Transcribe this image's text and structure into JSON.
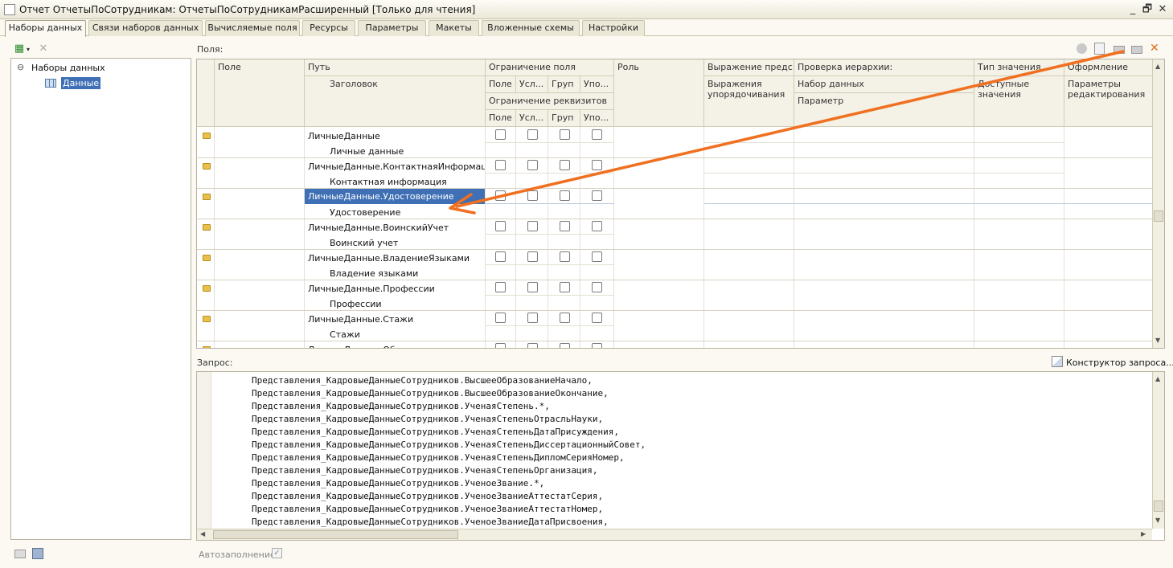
{
  "window": {
    "title": "Отчет ОтчетыПоСотрудникам: ОтчетыПоСотрудникамРасширенный [Только для чтения]",
    "controls": [
      "_",
      "🗗",
      "✕"
    ]
  },
  "tabs": [
    "Наборы данных",
    "Связи наборов данных",
    "Вычисляемые поля",
    "Ресурсы",
    "Параметры",
    "Макеты",
    "Вложенные схемы",
    "Настройки"
  ],
  "tree": {
    "root": "Наборы данных",
    "child": "Данные",
    "collapse_glyph": "⊖"
  },
  "fields_label": "Поля:",
  "grid": {
    "headers": {
      "pole": "Поле",
      "put": "Путь",
      "zagolovok": "Заголовок",
      "ogr_polya": "Ограничение поля",
      "ogr_sub": [
        "Поле",
        "Усл...",
        "Груп",
        "Упо..."
      ],
      "ogr_rekv": "Ограничение реквизитов",
      "rekv_sub": [
        "Поле",
        "Усл...",
        "Груп",
        "Упо..."
      ],
      "rol": "Роль",
      "vyrazhenie": "Выражение предс...",
      "vyrazheniya_upor": "Выражения упорядочивания",
      "proverka": "Проверка иерархии:",
      "nabor": "Набор данных",
      "parametr": "Параметр",
      "tip": "Тип значения",
      "dostupnye": "Доступные значения",
      "oformlenie": "Оформление",
      "parametry_red": "Параметры редактирования"
    },
    "rows": [
      {
        "path": "ЛичныеДанные",
        "title": "Личные данные"
      },
      {
        "path": "ЛичныеДанные.КонтактнаяИнформация",
        "title": "Контактная информация"
      },
      {
        "path": "ЛичныеДанные.Удостоверение",
        "title": "Удостоверение"
      },
      {
        "path": "ЛичныеДанные.ВоинскийУчет",
        "title": "Воинский учет"
      },
      {
        "path": "ЛичныеДанные.ВладениеЯзыками",
        "title": "Владение языками"
      },
      {
        "path": "ЛичныеДанные.Профессии",
        "title": "Профессии"
      },
      {
        "path": "ЛичныеДанные.Стажи",
        "title": "Стажи"
      },
      {
        "path": "ЛичныеДанные.Образование",
        "title": ""
      }
    ],
    "selected_row": 2
  },
  "query": {
    "label": "Запрос:",
    "builder": "Конструктор запроса...",
    "lines": [
      "Представления_КадровыеДанныеСотрудников.ВысшееОбразованиеНачало,",
      "Представления_КадровыеДанныеСотрудников.ВысшееОбразованиеОкончание,",
      "Представления_КадровыеДанныеСотрудников.УченаяСтепень.*,",
      "Представления_КадровыеДанныеСотрудников.УченаяСтепеньОтрасльНауки,",
      "Представления_КадровыеДанныеСотрудников.УченаяСтепеньДатаПрисуждения,",
      "Представления_КадровыеДанныеСотрудников.УченаяСтепеньДиссертационныйСовет,",
      "Представления_КадровыеДанныеСотрудников.УченаяСтепеньДипломСерияНомер,",
      "Представления_КадровыеДанныеСотрудников.УченаяСтепеньОрганизация,",
      "Представления_КадровыеДанныеСотрудников.УченоеЗвание.*,",
      "Представления_КадровыеДанныеСотрудников.УченоеЗваниеАттестатСерия,",
      "Представления_КадровыеДанныеСотрудников.УченоеЗваниеАттестатНомер,",
      "Представления_КадровыеДанныеСотрудников.УченоеЗваниеДатаПрисвоения,"
    ]
  },
  "autofill": {
    "label": "Автозаполнение",
    "checked": true
  },
  "colors": {
    "accent_arrow": "#f07020",
    "selection": "#3f6fb5"
  }
}
